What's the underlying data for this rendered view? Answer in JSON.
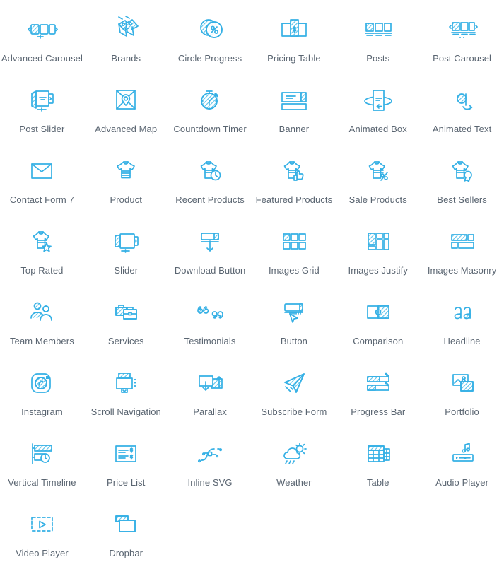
{
  "theme": {
    "background": "#ffffff",
    "icon_color": "#35b0e5",
    "icon_fill_hatch": "#5ec3ea",
    "label_color": "#5a6571"
  },
  "grid": {
    "columns": 6,
    "rows": 8,
    "total_items": 44
  },
  "items": [
    {
      "label": "Advanced Carousel",
      "icon": "advanced-carousel-icon"
    },
    {
      "label": "Brands",
      "icon": "brands-icon"
    },
    {
      "label": "Circle Progress",
      "icon": "circle-progress-icon"
    },
    {
      "label": "Pricing Table",
      "icon": "pricing-table-icon"
    },
    {
      "label": "Posts",
      "icon": "posts-icon"
    },
    {
      "label": "Post Carousel",
      "icon": "post-carousel-icon"
    },
    {
      "label": "Post Slider",
      "icon": "post-slider-icon"
    },
    {
      "label": "Advanced Map",
      "icon": "advanced-map-icon"
    },
    {
      "label": "Countdown Timer",
      "icon": "countdown-timer-icon"
    },
    {
      "label": "Banner",
      "icon": "banner-icon"
    },
    {
      "label": "Animated Box",
      "icon": "animated-box-icon"
    },
    {
      "label": "Animated Text",
      "icon": "animated-text-icon"
    },
    {
      "label": "Contact Form 7",
      "icon": "contact-form-icon"
    },
    {
      "label": "Product",
      "icon": "product-icon"
    },
    {
      "label": "Recent Products",
      "icon": "recent-products-icon"
    },
    {
      "label": "Featured Products",
      "icon": "featured-products-icon"
    },
    {
      "label": "Sale Products",
      "icon": "sale-products-icon"
    },
    {
      "label": "Best Sellers",
      "icon": "best-sellers-icon"
    },
    {
      "label": "Top Rated",
      "icon": "top-rated-icon"
    },
    {
      "label": "Slider",
      "icon": "slider-icon"
    },
    {
      "label": "Download Button",
      "icon": "download-button-icon"
    },
    {
      "label": "Images Grid",
      "icon": "images-grid-icon"
    },
    {
      "label": "Images Justify",
      "icon": "images-justify-icon"
    },
    {
      "label": "Images Masonry",
      "icon": "images-masonry-icon"
    },
    {
      "label": "Team Members",
      "icon": "team-members-icon"
    },
    {
      "label": "Services",
      "icon": "services-icon"
    },
    {
      "label": "Testimonials",
      "icon": "testimonials-icon"
    },
    {
      "label": "Button",
      "icon": "button-icon"
    },
    {
      "label": "Comparison",
      "icon": "comparison-icon"
    },
    {
      "label": "Headline",
      "icon": "headline-icon"
    },
    {
      "label": "Instagram",
      "icon": "instagram-icon"
    },
    {
      "label": "Scroll Navigation",
      "icon": "scroll-navigation-icon"
    },
    {
      "label": "Parallax",
      "icon": "parallax-icon"
    },
    {
      "label": "Subscribe Form",
      "icon": "subscribe-form-icon"
    },
    {
      "label": "Progress Bar",
      "icon": "progress-bar-icon"
    },
    {
      "label": "Portfolio",
      "icon": "portfolio-icon"
    },
    {
      "label": "Vertical Timeline",
      "icon": "vertical-timeline-icon"
    },
    {
      "label": "Price List",
      "icon": "price-list-icon"
    },
    {
      "label": "Inline SVG",
      "icon": "inline-svg-icon"
    },
    {
      "label": "Weather",
      "icon": "weather-icon"
    },
    {
      "label": "Table",
      "icon": "table-icon"
    },
    {
      "label": "Audio Player",
      "icon": "audio-player-icon"
    },
    {
      "label": "Video Player",
      "icon": "video-player-icon"
    },
    {
      "label": "Dropbar",
      "icon": "dropbar-icon"
    }
  ]
}
